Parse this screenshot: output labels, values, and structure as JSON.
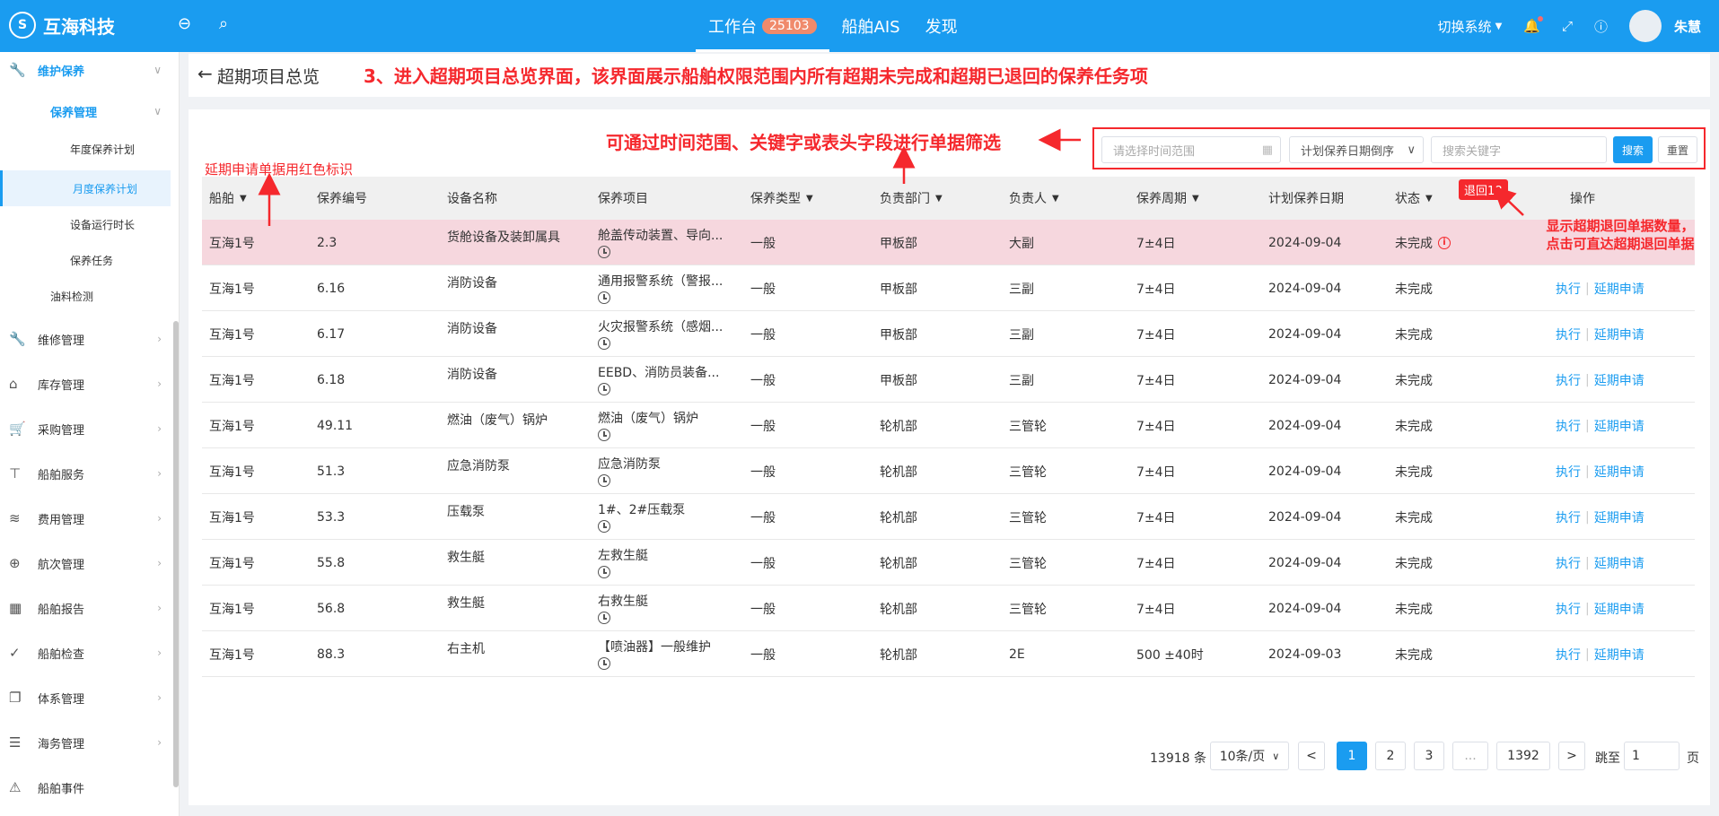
{
  "app": {
    "logo_text": "互海科技",
    "logo_mark": "S"
  },
  "topnav": {
    "items": [
      {
        "label": "工作台",
        "badge": "25103"
      },
      {
        "label": "船舶AIS"
      },
      {
        "label": "发现"
      }
    ],
    "switch_system": "切换系统",
    "user_name": "朱慧"
  },
  "sidebar": {
    "maintenance": "维护保养",
    "maintenance_mgmt": "保养管理",
    "annual_plan": "年度保养计划",
    "monthly_plan": "月度保养计划",
    "runtime": "设备运行时长",
    "tasks": "保养任务",
    "oil_test": "油料检测",
    "repair": "维修管理",
    "inventory": "库存管理",
    "purchase": "采购管理",
    "ship_service": "船舶服务",
    "expense": "费用管理",
    "voyage": "航次管理",
    "report": "船舶报告",
    "inspection": "船舶检查",
    "system_mgmt": "体系管理",
    "maritime": "海务管理",
    "events": "船舶事件"
  },
  "page": {
    "title": "超期项目总览",
    "annotation_header": "3、进入超期项目总览界面，该界面展示船舶权限范围内所有超期未完成和超期已退回的保养任务项",
    "annotation_filter": "可通过时间范围、关键字或表头字段进行单据筛选",
    "annotation_red": "延期申请单据用红色标识",
    "annotation_returned_1": "显示超期退回单据数量，",
    "annotation_returned_2": "点击可直达超期退回单据"
  },
  "filters": {
    "date_placeholder": "请选择时间范围",
    "sort_value": "计划保养日期倒序",
    "keyword_placeholder": "搜索关键字",
    "search_label": "搜索",
    "reset_label": "重置"
  },
  "table": {
    "headers": {
      "ship": "船舶",
      "code": "保养编号",
      "equipment": "设备名称",
      "item": "保养项目",
      "type": "保养类型",
      "dept": "负责部门",
      "owner": "负责人",
      "cycle": "保养周期",
      "plan_date": "计划保养日期",
      "status": "状态",
      "ops": "操作"
    },
    "returned_badge": "退回18",
    "op_execute": "执行",
    "op_extend": "延期申请",
    "rows": [
      {
        "ship": "互海1号",
        "code": "2.3",
        "equipment": "货舱设备及装卸属具",
        "item": "舱盖传动装置、导向...",
        "type": "一般",
        "dept": "甲板部",
        "owner": "大副",
        "cycle": "7±4日",
        "plan_date": "2024-09-04",
        "status": "未完成"
      },
      {
        "ship": "互海1号",
        "code": "6.16",
        "equipment": "消防设备",
        "item": "通用报警系统（警报...",
        "type": "一般",
        "dept": "甲板部",
        "owner": "三副",
        "cycle": "7±4日",
        "plan_date": "2024-09-04",
        "status": "未完成"
      },
      {
        "ship": "互海1号",
        "code": "6.17",
        "equipment": "消防设备",
        "item": "火灾报警系统（感烟...",
        "type": "一般",
        "dept": "甲板部",
        "owner": "三副",
        "cycle": "7±4日",
        "plan_date": "2024-09-04",
        "status": "未完成"
      },
      {
        "ship": "互海1号",
        "code": "6.18",
        "equipment": "消防设备",
        "item": "EEBD、消防员装备...",
        "type": "一般",
        "dept": "甲板部",
        "owner": "三副",
        "cycle": "7±4日",
        "plan_date": "2024-09-04",
        "status": "未完成"
      },
      {
        "ship": "互海1号",
        "code": "49.11",
        "equipment": "燃油（废气）锅炉",
        "item": "燃油（废气）锅炉",
        "type": "一般",
        "dept": "轮机部",
        "owner": "三管轮",
        "cycle": "7±4日",
        "plan_date": "2024-09-04",
        "status": "未完成"
      },
      {
        "ship": "互海1号",
        "code": "51.3",
        "equipment": "应急消防泵",
        "item": "应急消防泵",
        "type": "一般",
        "dept": "轮机部",
        "owner": "三管轮",
        "cycle": "7±4日",
        "plan_date": "2024-09-04",
        "status": "未完成"
      },
      {
        "ship": "互海1号",
        "code": "53.3",
        "equipment": "压载泵",
        "item": "1#、2#压载泵",
        "type": "一般",
        "dept": "轮机部",
        "owner": "三管轮",
        "cycle": "7±4日",
        "plan_date": "2024-09-04",
        "status": "未完成"
      },
      {
        "ship": "互海1号",
        "code": "55.8",
        "equipment": "救生艇",
        "item": "左救生艇",
        "type": "一般",
        "dept": "轮机部",
        "owner": "三管轮",
        "cycle": "7±4日",
        "plan_date": "2024-09-04",
        "status": "未完成"
      },
      {
        "ship": "互海1号",
        "code": "56.8",
        "equipment": "救生艇",
        "item": "右救生艇",
        "type": "一般",
        "dept": "轮机部",
        "owner": "三管轮",
        "cycle": "7±4日",
        "plan_date": "2024-09-04",
        "status": "未完成"
      },
      {
        "ship": "互海1号",
        "code": "88.3",
        "equipment": "右主机",
        "item": "【喷油器】一般维护",
        "type": "一般",
        "dept": "轮机部",
        "owner": "2E",
        "cycle": "500 ±40时",
        "plan_date": "2024-09-03",
        "status": "未完成"
      }
    ]
  },
  "pagination": {
    "total": "13918 条",
    "page_size": "10条/页",
    "prev": "<",
    "next": ">",
    "pages": [
      "1",
      "2",
      "3",
      "...",
      "1392"
    ],
    "goto_label": "跳至",
    "goto_value": "1",
    "page_unit": "页"
  }
}
